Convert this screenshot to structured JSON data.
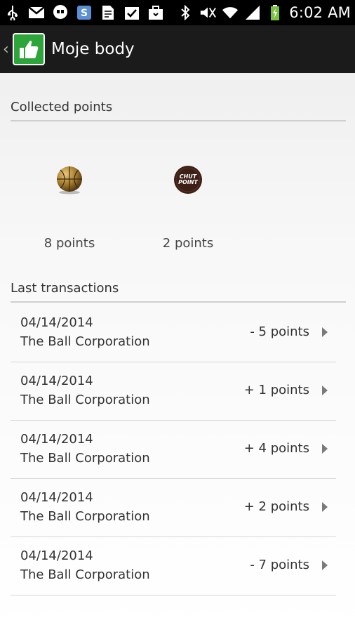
{
  "status_bar": {
    "time": "6:02 AM",
    "icons": [
      "usb-icon",
      "gmail-icon",
      "hangouts-icon",
      "skype-icon",
      "document-icon",
      "task-icon",
      "briefcase-icon",
      "bluetooth-icon",
      "mute-icon",
      "wifi-icon",
      "signal-icon",
      "battery-icon"
    ]
  },
  "action_bar": {
    "title": "Moje body",
    "app_icon": "thumbs-up-icon"
  },
  "collected": {
    "header": "Collected points",
    "items": [
      {
        "label": "8 points",
        "icon": "ball-icon"
      },
      {
        "label": "2 points",
        "icon": "chut-point-logo",
        "logo_text": "CHUT POINT"
      }
    ]
  },
  "transactions": {
    "header": "Last transactions",
    "items": [
      {
        "date": "04/14/2014",
        "company": "The Ball Corporation",
        "amount": "- 5 points"
      },
      {
        "date": "04/14/2014",
        "company": "The Ball Corporation",
        "amount": "+ 1 points"
      },
      {
        "date": "04/14/2014",
        "company": "The Ball Corporation",
        "amount": "+ 4 points"
      },
      {
        "date": "04/14/2014",
        "company": "The Ball Corporation",
        "amount": "+ 2 points"
      },
      {
        "date": "04/14/2014",
        "company": "The Ball Corporation",
        "amount": "- 7 points"
      }
    ]
  },
  "colors": {
    "app_icon_green": "#2ea53a",
    "action_bar_bg": "#1b1b1b",
    "status_bar_bg": "#000000",
    "battery_green": "#7bc043"
  }
}
